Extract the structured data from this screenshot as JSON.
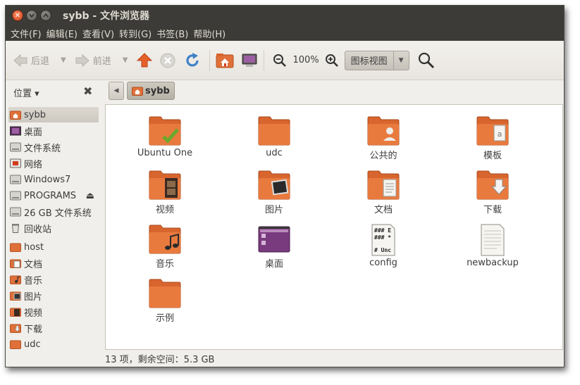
{
  "window": {
    "title": "sybb - 文件浏览器"
  },
  "menu": [
    "文件(F)",
    "编辑(E)",
    "查看(V)",
    "转到(G)",
    "书签(B)",
    "帮助(H)"
  ],
  "toolbar": {
    "back_label": "后退",
    "forward_label": "前进",
    "zoom_level": "100%",
    "view_mode": "图标视图"
  },
  "places": {
    "header": "位置 ▾",
    "items": [
      {
        "label": "sybb",
        "icon": "home-folder-icon",
        "selected": true
      },
      {
        "label": "桌面",
        "icon": "desktop-icon"
      },
      {
        "label": "文件系统",
        "icon": "drive-icon"
      },
      {
        "label": "网络",
        "icon": "network-icon"
      },
      {
        "label": "Windows7",
        "icon": "drive-icon"
      },
      {
        "label": "PROGRAMS",
        "icon": "drive-icon",
        "eject": true
      },
      {
        "label": "26 GB 文件系统",
        "icon": "drive-icon"
      },
      {
        "label": "回收站",
        "icon": "trash-icon"
      },
      {
        "label": "host",
        "icon": "folder-icon"
      },
      {
        "label": "文档",
        "icon": "documents-folder-icon"
      },
      {
        "label": "音乐",
        "icon": "music-folder-icon"
      },
      {
        "label": "图片",
        "icon": "pictures-folder-icon"
      },
      {
        "label": "视频",
        "icon": "videos-folder-icon"
      },
      {
        "label": "下载",
        "icon": "downloads-folder-icon"
      },
      {
        "label": "udc",
        "icon": "folder-icon"
      }
    ]
  },
  "location": {
    "crumb": "sybb"
  },
  "files": [
    {
      "label": "Ubuntu One",
      "icon": "ubuntu-one-folder-icon"
    },
    {
      "label": "udc",
      "icon": "folder-icon"
    },
    {
      "label": "公共的",
      "icon": "public-folder-icon"
    },
    {
      "label": "模板",
      "icon": "templates-folder-icon"
    },
    {
      "label": "视频",
      "icon": "videos-folder-icon"
    },
    {
      "label": "图片",
      "icon": "pictures-folder-icon"
    },
    {
      "label": "文档",
      "icon": "documents-folder-icon"
    },
    {
      "label": "下载",
      "icon": "downloads-folder-icon"
    },
    {
      "label": "音乐",
      "icon": "music-folder-icon"
    },
    {
      "label": "桌面",
      "icon": "desktop-folder-icon"
    },
    {
      "label": "config",
      "icon": "script-file-icon",
      "script_lines": [
        "### E",
        "### *",
        "# Unc"
      ]
    },
    {
      "label": "newbackup",
      "icon": "text-file-icon"
    },
    {
      "label": "示例",
      "icon": "examples-folder-icon"
    }
  ],
  "status": "13 项，剩余空间：5.3 GB",
  "colors": {
    "titlebar": "#3c3b37",
    "folder_orange": "#e0703a",
    "accent_orange": "#dd4814"
  }
}
